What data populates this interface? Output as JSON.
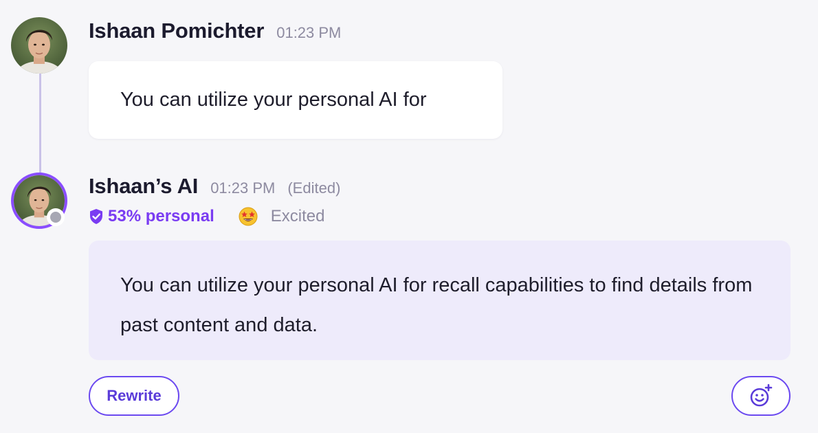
{
  "messages": [
    {
      "sender": "Ishaan Pomichter",
      "time": "01:23 PM",
      "text": "You can utilize your personal AI for",
      "avatar_icon": "user-avatar-photo"
    },
    {
      "sender": "Ishaan’s AI",
      "time": "01:23 PM",
      "edited_label": "(Edited)",
      "personal_label": "53% personal",
      "personal_icon": "shield-check-icon",
      "mood_icon": "star-struck-emoji-icon",
      "mood_label": "Excited",
      "text": "You can utilize your personal AI for recall capabilities to find details from past content and data.",
      "avatar_icon": "ai-avatar-photo",
      "presence": "offline"
    }
  ],
  "actions": {
    "rewrite_label": "Rewrite",
    "reaction_icon": "add-reaction-icon"
  },
  "colors": {
    "accent": "#7a3cf2",
    "button_border": "#6b49f0",
    "ai_bubble_bg": "#eeebfb",
    "human_bubble_bg": "#ffffff",
    "page_bg": "#f6f6f9",
    "thread_line": "#c9c2e8"
  }
}
